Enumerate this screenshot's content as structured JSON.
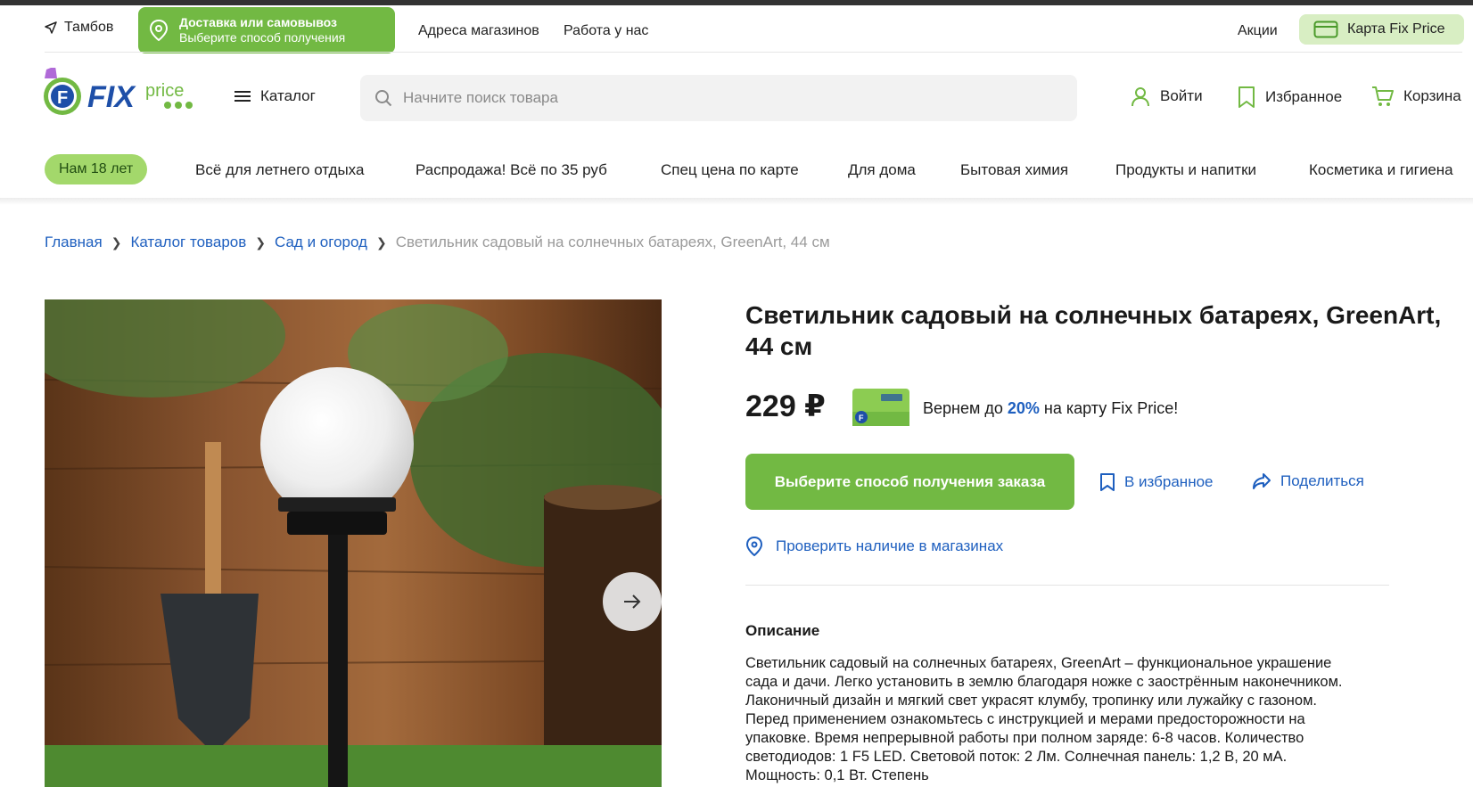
{
  "topbar": {
    "city": "Тамбов",
    "delivery_title": "Доставка или самовывоз",
    "delivery_subtitle": "Выберите способ получения",
    "links": [
      "Адреса магазинов",
      "Работа у нас"
    ],
    "promo_link": "Акции",
    "card_label": "Карта Fix Price"
  },
  "header": {
    "logo_text": "FIX price",
    "catalog_label": "Каталог",
    "search_placeholder": "Начните поиск товара",
    "login_label": "Войти",
    "favorites_label": "Избранное",
    "cart_label": "Корзина"
  },
  "nav": {
    "pill": "Нам 18 лет",
    "items": [
      "Всё для летнего отдыха",
      "Распродажа! Всё по 35 руб",
      "Спец цена по карте",
      "Для дома",
      "Бытовая химия",
      "Продукты и напитки",
      "Косметика и гигиена"
    ]
  },
  "breadcrumbs": {
    "items": [
      "Главная",
      "Каталог товаров",
      "Сад и огород"
    ],
    "current": "Светильник садовый на солнечных батареях, GreenArt, 44 см"
  },
  "product": {
    "title": "Светильник садовый на солнечных батареях, GreenArt, 44 см",
    "price": "229 ₽",
    "cashback_prefix": "Вернем до ",
    "cashback_percent": "20%",
    "cashback_suffix": " на карту Fix Price!",
    "order_button": "Выберите способ получения заказа",
    "favorite_button": "В избранное",
    "share_button": "Поделиться",
    "stock_link": "Проверить наличие в магазинах",
    "description_title": "Описание",
    "description": "Светильник садовый на солнечных батареях, GreenArt – функциональное украшение сада и дачи. Легко установить в землю благодаря ножке с заострённым наконечником. Лаконичный дизайн и мягкий свет украсят клумбу, тропинку или лужайку с газоном. Перед применением ознакомьтесь с инструкцией и мерами предосторожности на упаковке. Время непрерывной работы при полном заряде: 6-8 часов. Количество светодиодов: 1 F5 LED. Световой поток: 2 Лм. Солнечная панель: 1,2 В, 20 мА. Мощность: 0,1 Вт. Степень"
  },
  "colors": {
    "brand_green": "#72b943",
    "link_blue": "#1e5fbf",
    "pill_green": "#a3d86b"
  }
}
